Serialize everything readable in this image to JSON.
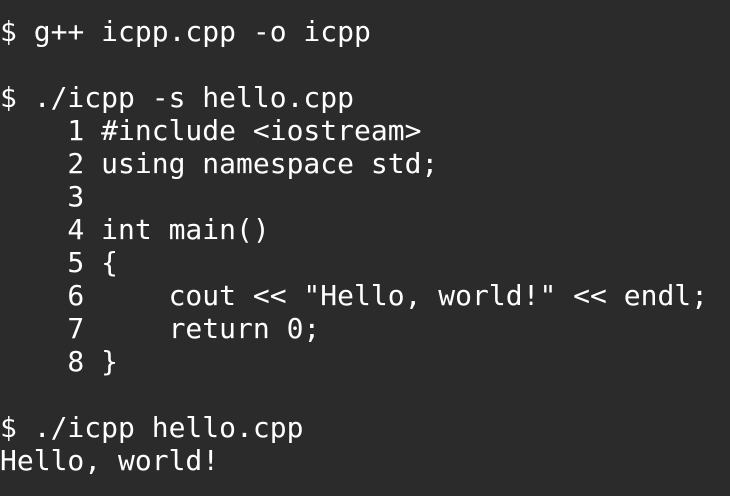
{
  "terminal": {
    "lines": [
      "$ g++ icpp.cpp -o icpp",
      "",
      "$ ./icpp -s hello.cpp",
      "    1 #include <iostream>",
      "    2 using namespace std;",
      "    3",
      "    4 int main()",
      "    5 {",
      "    6     cout << \"Hello, world!\" << endl;",
      "    7     return 0;",
      "    8 }",
      "",
      "$ ./icpp hello.cpp",
      "Hello, world!"
    ]
  }
}
